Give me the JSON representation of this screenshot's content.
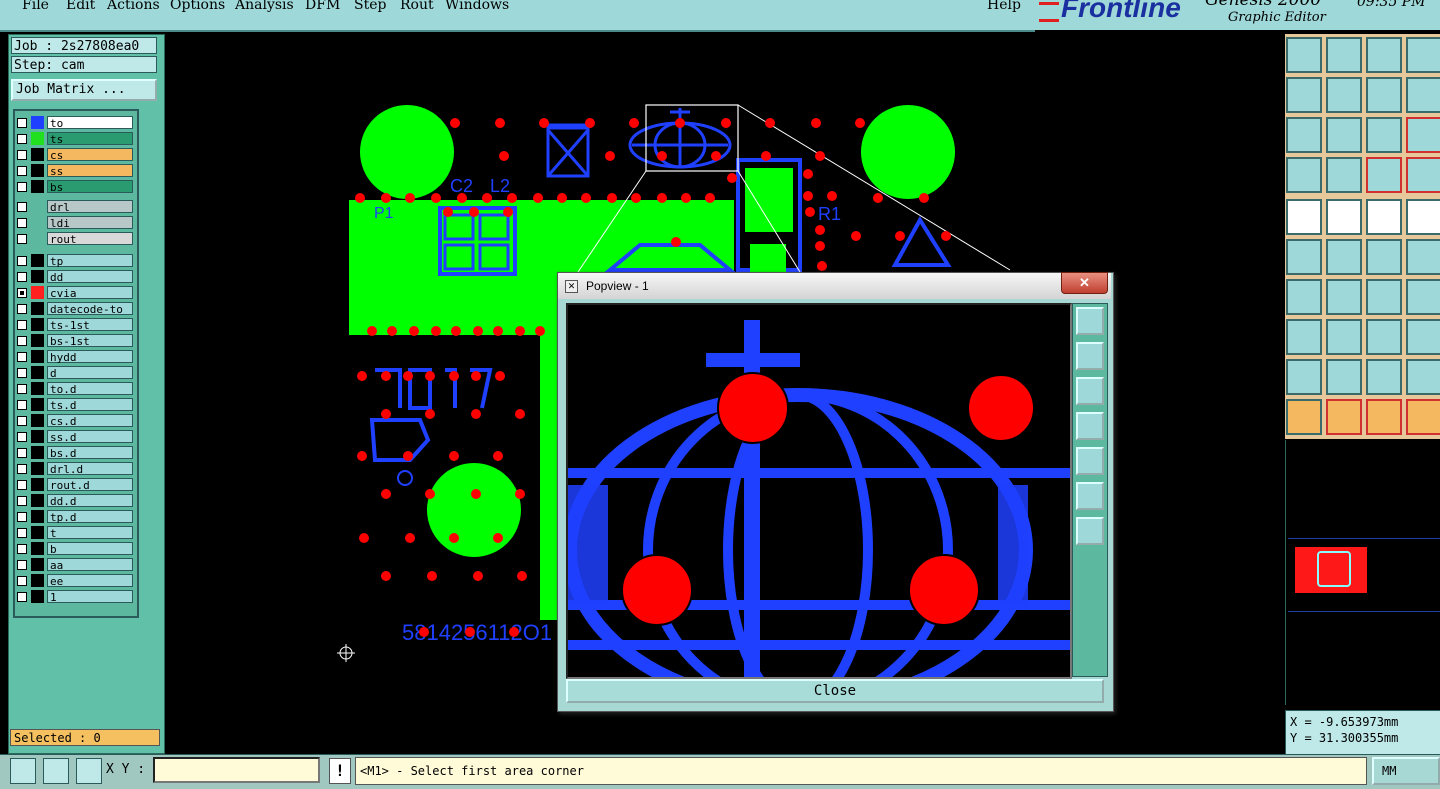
{
  "menu": {
    "file": "File",
    "edit": "Edit",
    "actions": "Actions",
    "options": "Options",
    "analysis": "Analysis",
    "dfm": "DFM",
    "step": "Step",
    "rout": "Rout",
    "windows": "Windows",
    "help": "Help"
  },
  "brand": {
    "logo": "Frontline",
    "product": "Genesis 2000",
    "subtitle": "Graphic Editor",
    "clock": "09:35 PM"
  },
  "job": {
    "job_label": "Job : 2s27808ea0",
    "step_label": "Step: cam",
    "matrix_button": "Job Matrix ..."
  },
  "layers_board": [
    {
      "name": "to",
      "color": "#2040ff",
      "flag": "✎"
    },
    {
      "name": "ts",
      "color": "#20e020",
      "flag": ""
    },
    {
      "name": "cs",
      "color": "#000000",
      "flag": ""
    },
    {
      "name": "ss",
      "color": "#000000",
      "flag": "✎"
    },
    {
      "name": "bs",
      "color": "#000000",
      "flag": "✎"
    }
  ],
  "layers_drill": [
    {
      "name": "drl"
    },
    {
      "name": "ldi"
    },
    {
      "name": "rout"
    }
  ],
  "layers_misc": [
    {
      "name": "tp",
      "color": "#000000",
      "flag": ""
    },
    {
      "name": "dd",
      "color": "#000000",
      "flag": ""
    },
    {
      "name": "cvia",
      "color": "#ff2020",
      "flag": "⊞"
    },
    {
      "name": "datecode-to",
      "color": "#000000",
      "flag": ""
    },
    {
      "name": "ts-1st",
      "color": "#000000",
      "flag": ""
    },
    {
      "name": "bs-1st",
      "color": "#000000",
      "flag": ""
    },
    {
      "name": "hydd",
      "color": "#000000",
      "flag": ""
    },
    {
      "name": "d",
      "color": "#000000",
      "flag": ""
    },
    {
      "name": "to.d",
      "color": "#000000",
      "flag": "✎"
    },
    {
      "name": "ts.d",
      "color": "#000000",
      "flag": ""
    },
    {
      "name": "cs.d",
      "color": "#000000",
      "flag": ""
    },
    {
      "name": "ss.d",
      "color": "#000000",
      "flag": "✎"
    },
    {
      "name": "bs.d",
      "color": "#000000",
      "flag": "✎"
    },
    {
      "name": "drl.d",
      "color": "#000000",
      "flag": ""
    },
    {
      "name": "rout.d",
      "color": "#000000",
      "flag": ""
    },
    {
      "name": "dd.d",
      "color": "#000000",
      "flag": ""
    },
    {
      "name": "tp.d",
      "color": "#000000",
      "flag": ""
    },
    {
      "name": "t",
      "color": "#000000",
      "flag": ""
    },
    {
      "name": "b",
      "color": "#000000",
      "flag": ""
    },
    {
      "name": "aa",
      "color": "#000000",
      "flag": ""
    },
    {
      "name": "ee",
      "color": "#000000",
      "flag": ""
    },
    {
      "name": "1",
      "color": "#000000",
      "flag": ""
    }
  ],
  "selected": "Selected : 0",
  "board": {
    "silk_labels": [
      "C2",
      "L2",
      "P1",
      "R1"
    ],
    "date_code": "5814256112O1"
  },
  "popview": {
    "title": "Popview - 1",
    "close_x": "✕",
    "close_button": "Close"
  },
  "coords": {
    "x": "X = -9.653973mm",
    "y": "Y = 31.300355mm"
  },
  "bottom": {
    "xy_label": "X Y :",
    "xy_value": "",
    "excl": "!",
    "prompt": "<M1> - Select first area corner",
    "units": "MM"
  },
  "colors": {
    "copper": "#00ff00",
    "pad": "#ff0000",
    "silk": "#2040ff",
    "panel": "#9fd8d8"
  }
}
